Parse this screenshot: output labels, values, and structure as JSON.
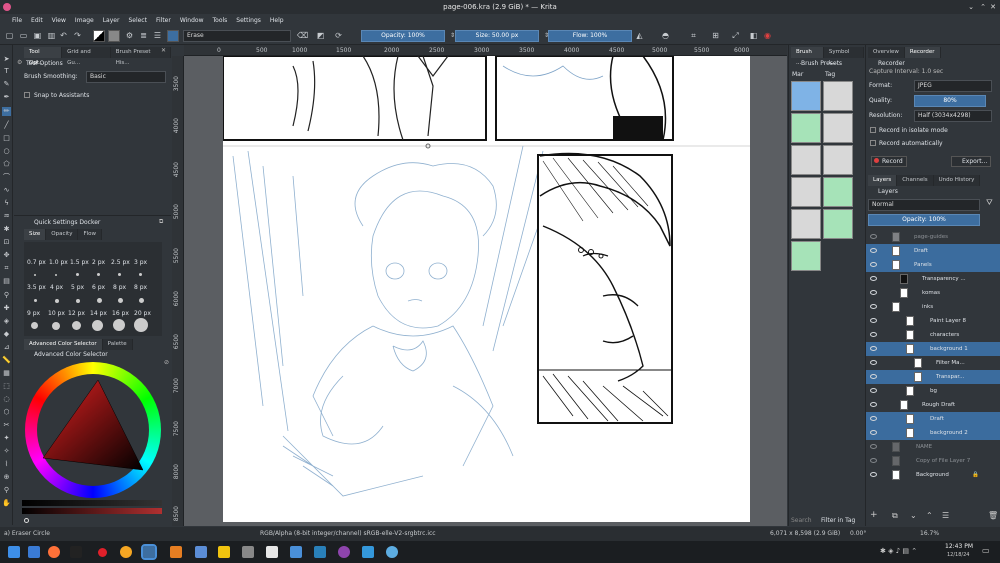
{
  "window": {
    "title": "page-006.kra (2.9 GiB) * — Krita"
  },
  "menu": [
    "File",
    "Edit",
    "View",
    "Image",
    "Layer",
    "Select",
    "Filter",
    "Window",
    "Tools",
    "Settings",
    "Help"
  ],
  "toolbar": {
    "brush_preset": "Erase",
    "opacity": "Opacity: 100%",
    "size": "Size: 50.00 px",
    "flow": "Flow: 100%"
  },
  "tool_options": {
    "tabs": [
      "Tool Opt...",
      "Grid and Gu...",
      "Brush Preset His..."
    ],
    "header": "Tool Options",
    "smoothing_label": "Brush Smoothing:",
    "smoothing_value": "Basic",
    "snap_label": "Snap to Assistants"
  },
  "quick_settings": {
    "title": "Quick Settings Docker",
    "tabs": [
      "Size",
      "Opacity",
      "Flow"
    ],
    "sizes": [
      "0.7 px",
      "1.0 px",
      "1.5 px",
      "2 px",
      "2.5 px",
      "3 px",
      "3.5 px",
      "4 px",
      "5 px",
      "6 px",
      "8 px",
      "8 px",
      "9 px",
      "10 px",
      "12 px",
      "14 px",
      "16 px",
      "20 px"
    ]
  },
  "color_selector": {
    "tabs": [
      "Advanced Color Selector",
      "Palette"
    ],
    "title": "Advanced Color Selector"
  },
  "ruler": {
    "h": [
      "0",
      "500",
      "1000",
      "1500",
      "2000",
      "2500",
      "3000",
      "3500",
      "4000",
      "4500",
      "5000",
      "5500",
      "6000"
    ],
    "v": [
      "3500",
      "4000",
      "4500",
      "5000",
      "5500",
      "6000",
      "6500",
      "7000",
      "7500",
      "8000",
      "8500"
    ]
  },
  "brush_presets": {
    "tabs": [
      "Brush ...",
      "Symbol L..."
    ],
    "title": "Brush Presets",
    "filter_label": "Mar",
    "tag_label": "Tag",
    "search_placeholder": "Search",
    "filter_in_tag": "Filter in Tag"
  },
  "right_top": {
    "tabs": [
      "Overview",
      "Recorder"
    ],
    "title": "Recorder",
    "capture_interval": "Capture Interval: 1.0 sec",
    "format_label": "Format:",
    "format_value": "JPEG",
    "quality_label": "Quality:",
    "quality_value": "80%",
    "resolution_label": "Resolution:",
    "resolution_value": "Half (3034x4298)",
    "isolate_label": "Record in isolate mode",
    "auto_label": "Record automatically",
    "record_btn": "Record",
    "export_btn": "Export..."
  },
  "layers_docker": {
    "tabs": [
      "Layers",
      "Channels",
      "Undo History"
    ],
    "title": "Layers",
    "blend": "Normal",
    "opacity": "Opacity: 100%",
    "layers": [
      "page-guides",
      "Draft",
      "Panels",
      "Transparency ...",
      "komas",
      "inks",
      "Paint Layer 8",
      "characters",
      "background 1",
      "Filter Ma...",
      "Transpar...",
      "bg",
      "Rough Draft",
      "Draft",
      "background 2",
      "NAME",
      "Copy of File Layer 7",
      "Background"
    ]
  },
  "status": {
    "tool": "a) Eraser Circle",
    "colorspace": "RGB/Alpha (8-bit integer/channel)  sRGB-elle-V2-srgbtrc.icc",
    "size": "6,071 x 8,598 (2.9 GiB)",
    "rotation": "0.00°",
    "zoom": "16.7%"
  },
  "taskbar": {
    "time": "12:43 PM",
    "date": "12/18/24"
  }
}
